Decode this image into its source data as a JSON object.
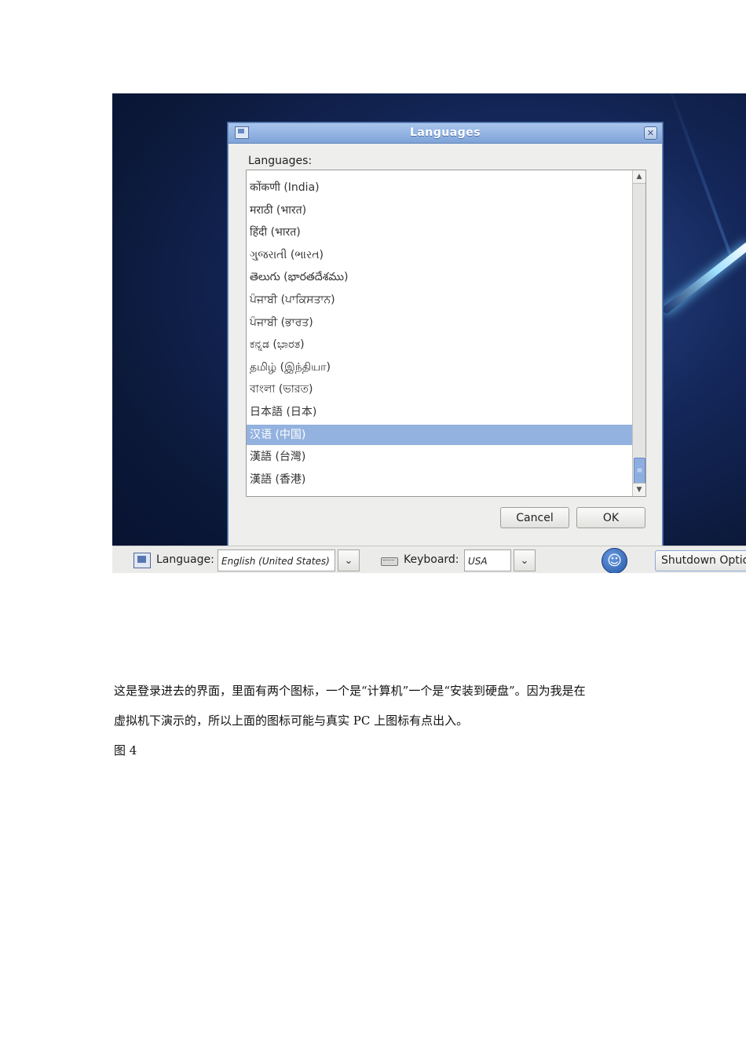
{
  "dialog": {
    "title": "Languages",
    "list_label": "Languages:",
    "languages": [
      "कोंकणी (India)",
      "मराठी (भारत)",
      "हिंदी (भारत)",
      "ગુજરાતી (ભારત)",
      "తెలుగు (భారతదేశము)",
      "ਪੰਜਾਬੀ (ਪਾਕਿਸਤਾਨ)",
      "ਪੰਜਾਬੀ (ਭਾਰਤ)",
      "ಕನ್ನಡ (ಭಾರತ)",
      "தமிழ் (இந்தியா)",
      "বাংলা (ভারত)",
      "日本語 (日本)",
      "汉语 (中国)",
      "漢語 (台灣)",
      "漢語 (香港)"
    ],
    "selected_language": "汉语 (中国)",
    "cancel_label": "Cancel",
    "ok_label": "OK"
  },
  "bottom_bar": {
    "language_label": "Language:",
    "language_value": "English (United States)",
    "keyboard_label": "Keyboard:",
    "keyboard_value": "USA",
    "shutdown_label": "Shutdown Optio"
  },
  "document": {
    "paragraph_line1": "这是登录进去的界面，里面有两个图标，一个是“计算机”一个是“安装到硬盘”。因为我是在",
    "paragraph_line2": "虚拟机下演示的，所以上面的图标可能与真实 PC 上图标有点出入。",
    "figure_label": "图 4"
  },
  "icons": [
    "flag-icon",
    "close-icon",
    "chevron-down-icon",
    "keyboard-icon",
    "accessibility-icon",
    "scroll-up-icon",
    "scroll-down-icon"
  ]
}
